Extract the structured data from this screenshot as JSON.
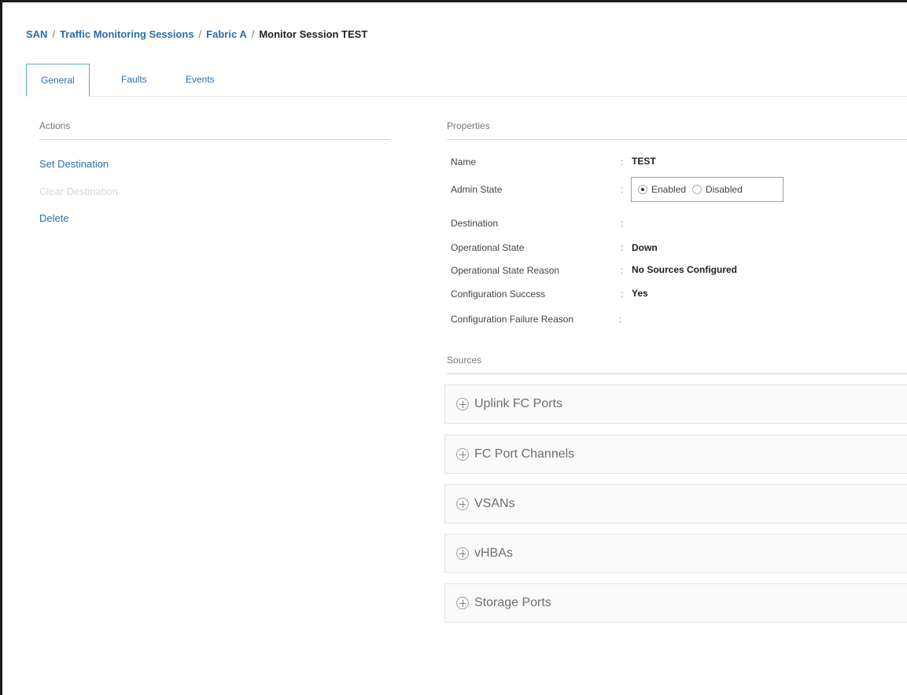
{
  "breadcrumb": {
    "items": [
      "SAN",
      "Traffic Monitoring Sessions",
      "Fabric A"
    ],
    "current": "Monitor Session TEST",
    "separator": "/"
  },
  "tabs": [
    {
      "label": "General",
      "active": true
    },
    {
      "label": "Faults",
      "active": false
    },
    {
      "label": "Events",
      "active": false
    }
  ],
  "actions": {
    "title": "Actions",
    "items": [
      {
        "label": "Set Destination",
        "enabled": true
      },
      {
        "label": "Clear Destination",
        "enabled": false
      },
      {
        "label": "Delete",
        "enabled": true
      }
    ]
  },
  "properties": {
    "title": "Properties",
    "name": {
      "label": "Name",
      "value": "TEST"
    },
    "admin_state": {
      "label": "Admin State",
      "options": [
        {
          "label": "Enabled",
          "selected": true
        },
        {
          "label": "Disabled",
          "selected": false
        }
      ]
    },
    "destination": {
      "label": "Destination",
      "value": ""
    },
    "operational_state": {
      "label": "Operational State",
      "value": "Down"
    },
    "operational_state_reason": {
      "label": "Operational State Reason",
      "value": "No Sources Configured"
    },
    "configuration_success": {
      "label": "Configuration Success",
      "value": "Yes"
    },
    "configuration_failure_reason": {
      "label": "Configuration Failure Reason",
      "value": ""
    },
    "colon": ":"
  },
  "sources": {
    "title": "Sources",
    "panels": [
      {
        "label": "Uplink FC Ports",
        "icon": "plus-circle-icon"
      },
      {
        "label": "FC Port Channels",
        "icon": "plus-circle-icon"
      },
      {
        "label": "VSANs",
        "icon": "plus-circle-icon"
      },
      {
        "label": "vHBAs",
        "icon": "plus-circle-icon"
      },
      {
        "label": "Storage Ports",
        "icon": "plus-circle-icon"
      }
    ]
  },
  "colors": {
    "link": "#2a6fa8",
    "active_tab_border": "#5aa7d6",
    "disabled_text": "#d3d6d9"
  }
}
